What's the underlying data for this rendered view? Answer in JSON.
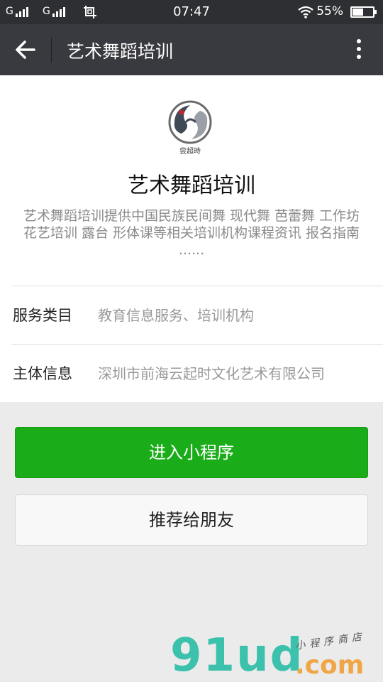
{
  "status_bar": {
    "signal_1_label": "G",
    "signal_2_label": "G",
    "time": "07:47",
    "battery_percent_text": "55%",
    "battery_level": 0.55,
    "icons": [
      "signal-bars-icon",
      "signal-bars-icon",
      "screenshot-icon",
      "wifi-icon",
      "battery-icon"
    ]
  },
  "title_bar": {
    "title": "艺术舞蹈培训",
    "back_icon": "arrow-left-icon",
    "more_icon": "more-vertical-icon"
  },
  "profile": {
    "logo_caption": "尝超時",
    "name": "艺术舞蹈培训",
    "description": "艺术舞蹈培训提供中国民族民间舞 现代舞 芭蕾舞 工作坊 花艺培训 露台 形体课等相关培训机构课程资讯 报名指南 ......"
  },
  "info_rows": [
    {
      "label": "服务类目",
      "value": "教育信息服务、培训机构"
    },
    {
      "label": "主体信息",
      "value": "深圳市前海云起时文化艺术有限公司"
    }
  ],
  "actions": {
    "enter_label": "进入小程序",
    "share_label": "推荐给朋友"
  },
  "watermark": {
    "logo_text": "91ud",
    "domain_text": ".com",
    "tagline": "小程序商店"
  },
  "colors": {
    "status_bar_bg": "#2e2f33",
    "title_bar_bg": "#393a3f",
    "primary_green": "#1aad19",
    "watermark_teal": "#3cc1ad",
    "watermark_orange": "#f0a646"
  }
}
